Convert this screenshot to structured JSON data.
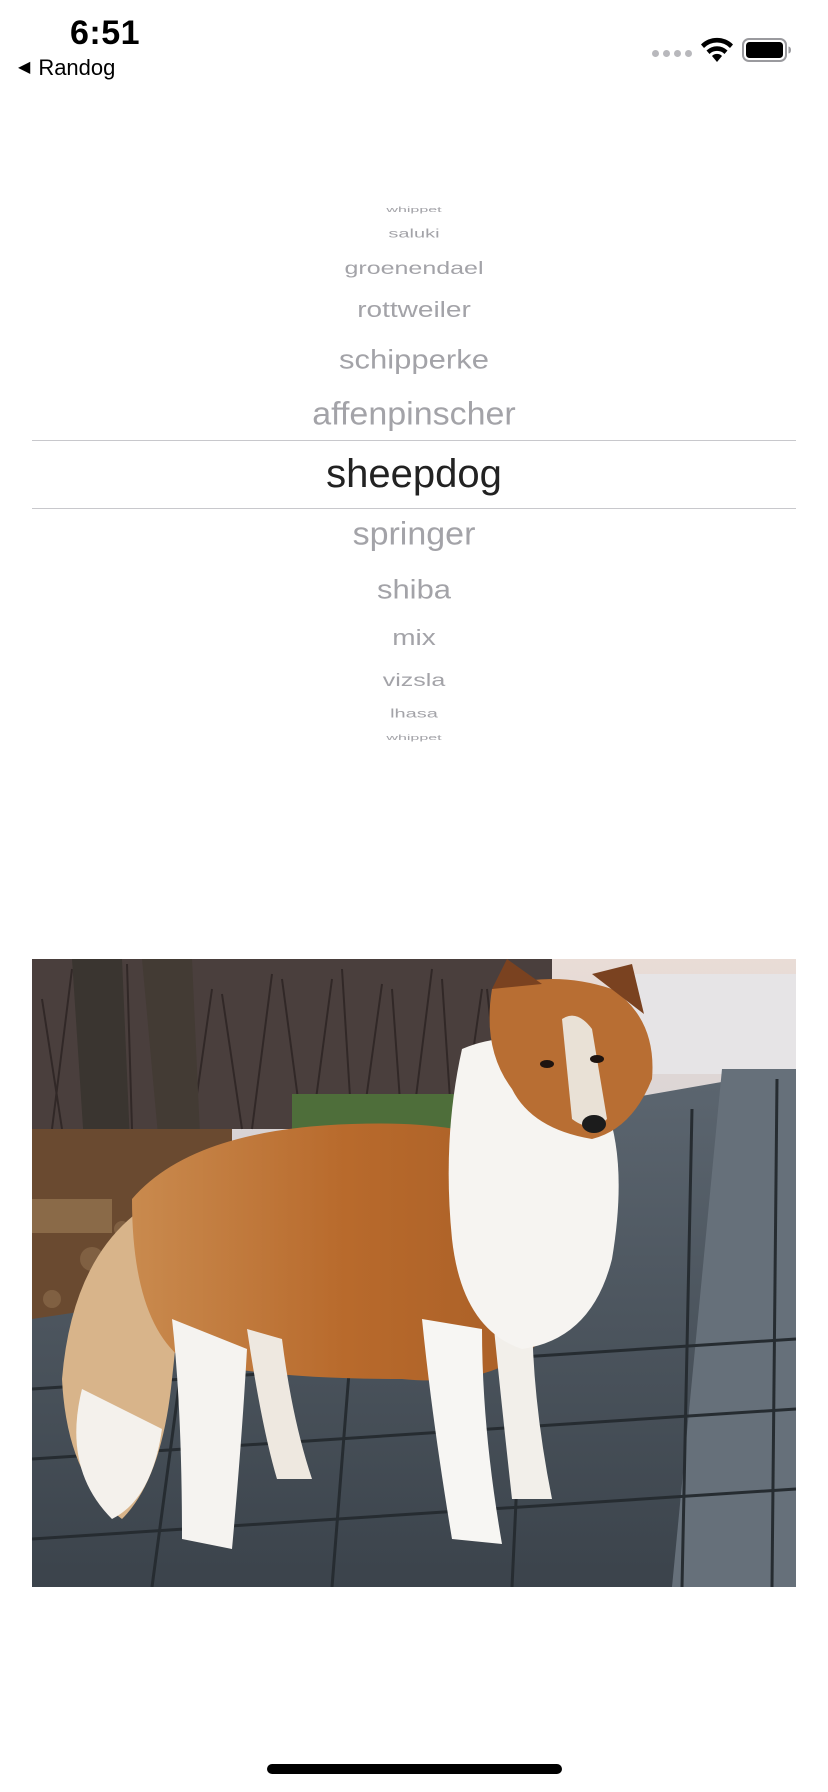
{
  "status_bar": {
    "time": "6:51",
    "back_app_label": "Randog",
    "back_icon": "back-triangle-icon",
    "signal_icon": "cellular-dots-icon",
    "wifi_icon": "wifi-icon",
    "battery_icon": "battery-icon"
  },
  "picker": {
    "selected_index": 6,
    "rows": [
      {
        "label": "whippet"
      },
      {
        "label": "saluki"
      },
      {
        "label": "groenendael"
      },
      {
        "label": "rottweiler"
      },
      {
        "label": "schipperke"
      },
      {
        "label": "affenpinscher"
      },
      {
        "label": "sheepdog"
      },
      {
        "label": "springer"
      },
      {
        "label": "shiba"
      },
      {
        "label": "mix"
      },
      {
        "label": "vizsla"
      },
      {
        "label": "lhasa"
      },
      {
        "label": "whippet"
      }
    ]
  },
  "photo": {
    "subject": "dog-photo-sheltie"
  },
  "colors": {
    "selected_text": "#222222",
    "unselected_text": "#a3a3a8",
    "divider": "#c8c8cc"
  }
}
